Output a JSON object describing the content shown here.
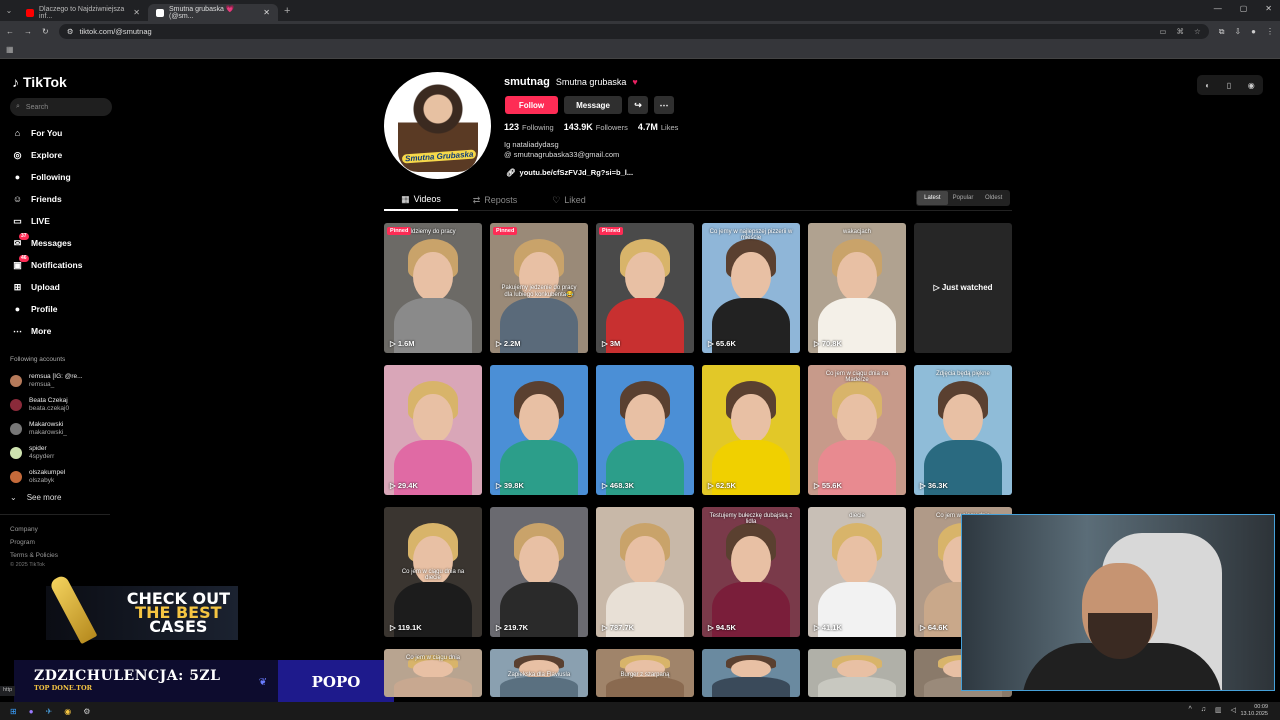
{
  "browser": {
    "tabs": [
      {
        "label": "Dlaczego to Najdziwniejsza inf...",
        "favicon_color": "#ff0000"
      },
      {
        "label": "Smutna grubaska 💗 (@sm...",
        "favicon_color": "#ffffff"
      }
    ],
    "url": "tiktok.com/@smutnag",
    "status_url": "http"
  },
  "sidebar": {
    "brand": "TikTok",
    "search_placeholder": "Search",
    "nav": [
      {
        "label": "For You",
        "icon": "home-icon",
        "glyph": "⌂"
      },
      {
        "label": "Explore",
        "icon": "compass-icon",
        "glyph": "◎"
      },
      {
        "label": "Following",
        "icon": "following-avatar-icon",
        "glyph": "●"
      },
      {
        "label": "Friends",
        "icon": "friends-icon",
        "glyph": "☺"
      },
      {
        "label": "LIVE",
        "icon": "live-icon",
        "glyph": "▭"
      },
      {
        "label": "Messages",
        "icon": "messages-icon",
        "glyph": "✉",
        "badge": "37"
      },
      {
        "label": "Notifications",
        "icon": "notifications-icon",
        "glyph": "▣",
        "badge": "46"
      },
      {
        "label": "Upload",
        "icon": "upload-icon",
        "glyph": "⊞"
      },
      {
        "label": "Profile",
        "icon": "profile-avatar-icon",
        "glyph": "●"
      },
      {
        "label": "More",
        "icon": "more-icon",
        "glyph": "⋯"
      }
    ],
    "following_title": "Following accounts",
    "following": [
      {
        "name": "remsua [IG: @re...",
        "handle": "remsua_",
        "color": "#b67a5a"
      },
      {
        "name": "Beata Czekaj",
        "handle": "beata.czekaj0",
        "color": "#8a2a3a"
      },
      {
        "name": "Makarowski",
        "handle": "makarowski_",
        "color": "#777777"
      },
      {
        "name": "spider",
        "handle": "4spyderr",
        "color": "#cfe3b0"
      },
      {
        "name": "olszakumpel",
        "handle": "olszabyk",
        "color": "#c46a3a"
      }
    ],
    "see_more": "See more",
    "footer": [
      "Company",
      "Program",
      "Terms & Policies"
    ],
    "copyright": "© 2025 TikTok"
  },
  "overlays": {
    "cases_line1": "CHECK OUT",
    "cases_line2": "THE BEST",
    "cases_line3": "CASES",
    "donate_main": "ZDZICHULENCJA: 5ZL",
    "donate_sub": "TOP DONE.TOR",
    "donate_right": "POPO"
  },
  "profile": {
    "username": "smutnag",
    "display_name": "Smutna grubaska",
    "avatar_label": "Smutna Grubaska",
    "follow_label": "Follow",
    "message_label": "Message",
    "following_count": "123",
    "following_label": "Following",
    "followers_count": "143.9K",
    "followers_label": "Followers",
    "likes_count": "4.7M",
    "likes_label": "Likes",
    "bio_line1": "Ig nataliadydasg",
    "bio_line2": "@ smutnagrubaska33@gmail.com",
    "link": "youtu.be/cfSzFVJd_Rg?si=b_l..."
  },
  "tabs": [
    {
      "label": "Videos",
      "glyph": "▦"
    },
    {
      "label": "Reposts",
      "glyph": "⇄"
    },
    {
      "label": "Liked",
      "glyph": "♡"
    }
  ],
  "sort": [
    "Latest",
    "Popular",
    "Oldest"
  ],
  "videos": [
    {
      "views": "1.6M",
      "pinned": "Pinned",
      "caption": "Idziemy do pracy",
      "bg": "#6c6a66",
      "hair": "#c9a36a",
      "body": "#8a8a8a"
    },
    {
      "views": "2.2M",
      "pinned": "Pinned",
      "mid": "Pakujemy jedzenie do pracy dla lubiego konkubenta😂",
      "bg": "#9a8a78",
      "hair": "#c9a36a",
      "body": "#5a6a7a"
    },
    {
      "views": "3M",
      "pinned": "Pinned",
      "bg": "#4a4a4a",
      "hair": "#d8b46a",
      "body": "#c83030"
    },
    {
      "views": "65.6K",
      "caption": "Co jemy w najlepszej pizzerii w mieście",
      "bg": "#8fb6d8",
      "hair": "#5a4030",
      "body": "#222222"
    },
    {
      "views": "70.8K",
      "caption": "wakacjach",
      "bg": "#b0a290",
      "hair": "#c9a36a",
      "body": "#f4f0e8"
    },
    {
      "views": "",
      "just": "Just watched",
      "bg": "#262626",
      "hair": "#333333",
      "body": "#2d2d2d"
    },
    {
      "views": "29.4K",
      "bg": "#d9a6b8",
      "hair": "#d8b46a",
      "body": "#e06aa4"
    },
    {
      "views": "39.8K",
      "bg": "#4b8fd6",
      "hair": "#5a4030",
      "body": "#2c9e8a"
    },
    {
      "views": "468.3K",
      "bg": "#4b8fd6",
      "hair": "#5a4030",
      "body": "#2c9e8a"
    },
    {
      "views": "62.5K",
      "bg": "#e2c828",
      "hair": "#5a4030",
      "body": "#f0d000"
    },
    {
      "views": "55.6K",
      "caption": "Co jem w ciągu dnia na Maderze",
      "bg": "#c79a8a",
      "hair": "#d8b46a",
      "body": "#e88a90"
    },
    {
      "views": "36.3K",
      "caption": "Zdjęcia będą piękne",
      "bg": "#8fbcd8",
      "hair": "#5a4030",
      "body": "#2a6a80"
    },
    {
      "views": "119.1K",
      "mid": "Co jem w ciągu dnia na diecie",
      "bg": "#3a3530",
      "hair": "#d8b46a",
      "body": "#1c1c1c"
    },
    {
      "views": "219.7K",
      "bg": "#6a6a70",
      "hair": "#c9a36a",
      "body": "#2a2a2a"
    },
    {
      "views": "787.7K",
      "bg": "#c8b8a8",
      "hair": "#c9a36a",
      "body": "#e8e0d6"
    },
    {
      "views": "94.5K",
      "caption": "Testujemy bułeczkę dubajską z lidla",
      "bg": "#7a3a4a",
      "hair": "#5a4030",
      "body": "#7a1e3a"
    },
    {
      "views": "41.1K",
      "caption": "diecie",
      "bg": "#c8bfb6",
      "hair": "#d8b46a",
      "body": "#f2f2f2"
    },
    {
      "views": "64.6K",
      "caption": "Co jem w ciągu dnia",
      "bg": "#b09a88",
      "hair": "#d8b46a",
      "body": "#c9a88a"
    },
    {
      "views": "",
      "caption": "Co jem w ciągu dnia",
      "bg": "#b8a490",
      "hair": "#d8b46a",
      "body": "#c8a890"
    },
    {
      "views": "",
      "mid": "Zapiekska dla Flaviusla",
      "bg": "#8aa0b0",
      "hair": "#5a4030",
      "body": "#5a7080"
    },
    {
      "views": "",
      "mid": "Burger z szarpaną",
      "bg": "#a0846a",
      "hair": "#d8b46a",
      "body": "#8a6a50"
    },
    {
      "views": "",
      "bg": "#6a8aa0",
      "hair": "#5a4030",
      "body": "#3a4a5a"
    },
    {
      "views": "",
      "bg": "#b0b0a8",
      "hair": "#d8b46a",
      "body": "#c8c8c0"
    },
    {
      "views": "",
      "bg": "#8a7a6a",
      "hair": "#d8b46a",
      "body": "#9a8a7a"
    }
  ],
  "clock": {
    "time": "00:09",
    "date": "13.10.2025"
  }
}
